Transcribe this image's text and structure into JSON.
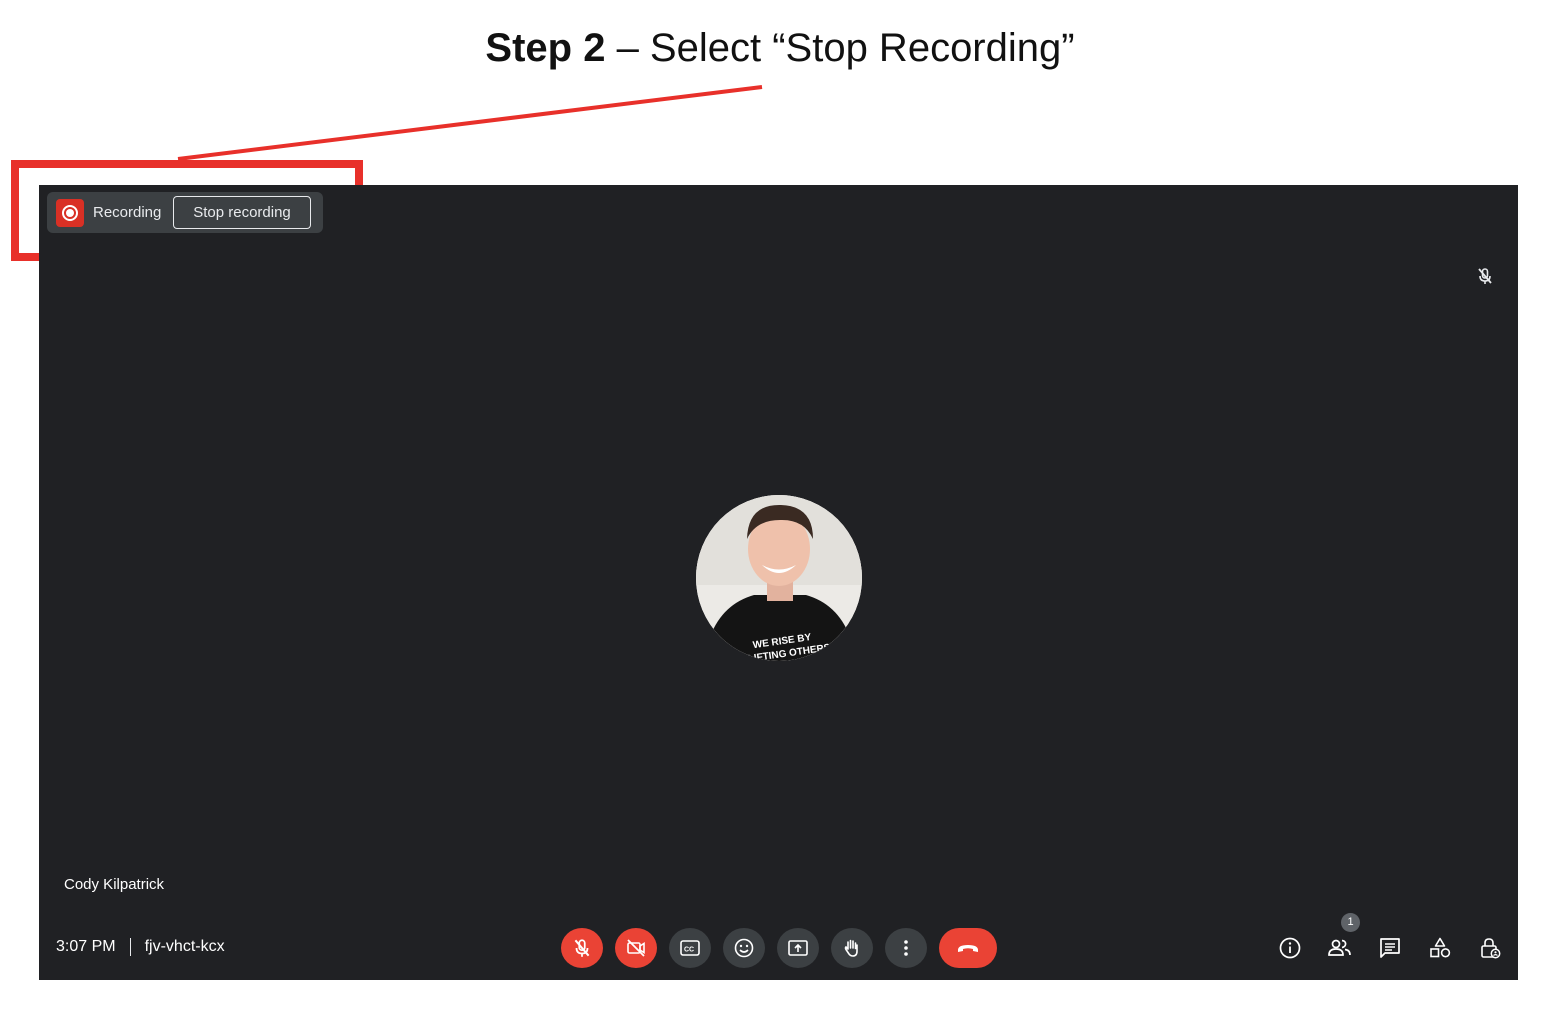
{
  "instruction": {
    "bold": "Step 2",
    "rest": " – Select “Stop Recording”"
  },
  "colors": {
    "highlight": "#e8302a",
    "meeting_bg": "#202124",
    "control_bg": "#3c4043",
    "danger": "#ea4335"
  },
  "recording": {
    "label": "Recording",
    "stop_label": "Stop recording"
  },
  "participant": {
    "name": "Cody Kilpatrick",
    "shirt_text_line1": "WE RISE BY",
    "shirt_text_line2": "LIFTING OTHERS"
  },
  "footer": {
    "time": "3:07 PM",
    "meeting_code": "fjv-vhct-kcx"
  },
  "controls": [
    "mic-off-icon",
    "camera-off-icon",
    "captions-icon",
    "emoji-icon",
    "present-icon",
    "raise-hand-icon",
    "more-options-icon",
    "leave-call-icon"
  ],
  "right_panel": {
    "icons": [
      "info-icon",
      "people-icon",
      "chat-icon",
      "activities-icon",
      "host-controls-icon"
    ],
    "people_count": "1"
  }
}
